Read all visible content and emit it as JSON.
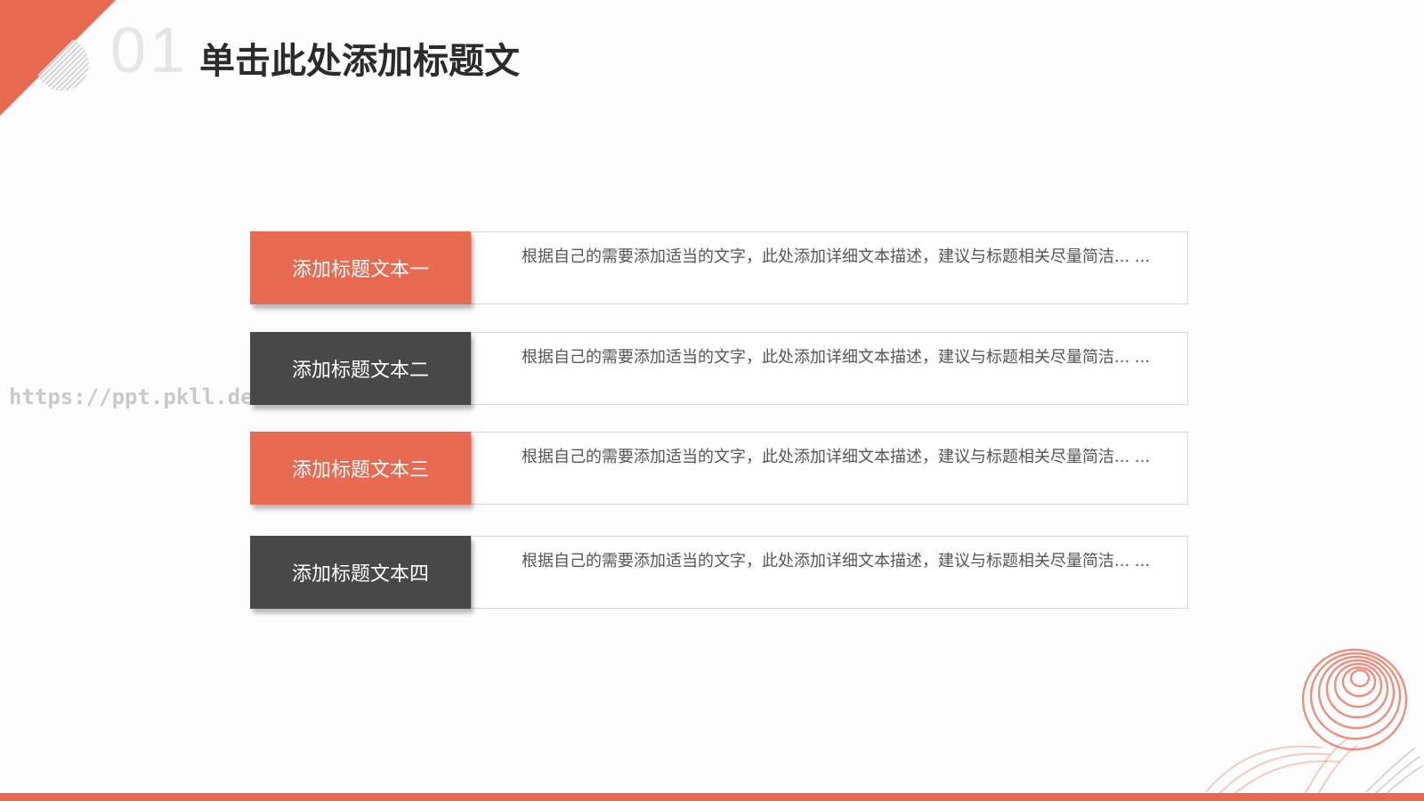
{
  "header": {
    "number": "01",
    "title": "单击此处添加标题文"
  },
  "watermark": "https://ppt.pkll.de",
  "rows": [
    {
      "label": "添加标题文本一",
      "text": "根据自己的需要添加适当的文字，此处添加详细文本描述，建议与标题相关尽量简洁... ...",
      "color": "#e86a51"
    },
    {
      "label": "添加标题文本二",
      "text": "根据自己的需要添加适当的文字，此处添加详细文本描述，建议与标题相关尽量简洁... ...",
      "color": "#484848"
    },
    {
      "label": "添加标题文本三",
      "text": "根据自己的需要添加适当的文字，此处添加详细文本描述，建议与标题相关尽量简洁... ...",
      "color": "#e86a51"
    },
    {
      "label": "添加标题文本四",
      "text": "根据自己的需要添加适当的文字，此处添加详细文本描述，建议与标题相关尽量简洁... ...",
      "color": "#484848"
    }
  ],
  "colors": {
    "accent": "#e86a51",
    "dark": "#484848"
  }
}
